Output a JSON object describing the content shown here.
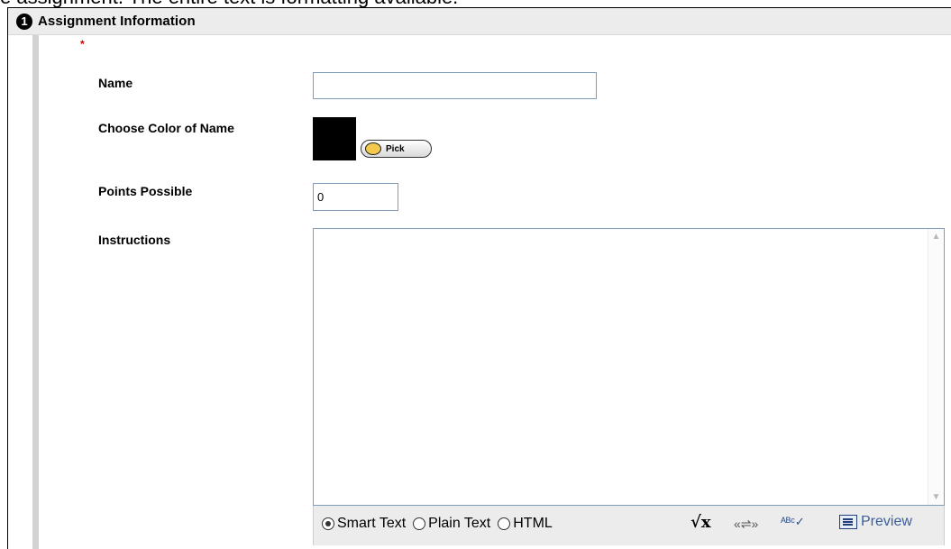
{
  "caption": "e assignment. The entire text is formatting available.",
  "section": {
    "step": "1",
    "title": "Assignment Information"
  },
  "fields": {
    "required_marker": "*",
    "name_label": "Name",
    "name_value": "",
    "color_label": "Choose Color of Name",
    "color_value": "#000000",
    "pick_label": "Pick",
    "points_label": "Points Possible",
    "points_value": "0",
    "instructions_label": "Instructions",
    "instructions_value": ""
  },
  "editor": {
    "modes": [
      "Smart Text",
      "Plain Text",
      "HTML"
    ],
    "selected_mode": "Smart Text",
    "preview_label": "Preview",
    "tools": [
      "math-equation-icon",
      "link-icon",
      "spell-check-icon",
      "preview-icon"
    ]
  }
}
